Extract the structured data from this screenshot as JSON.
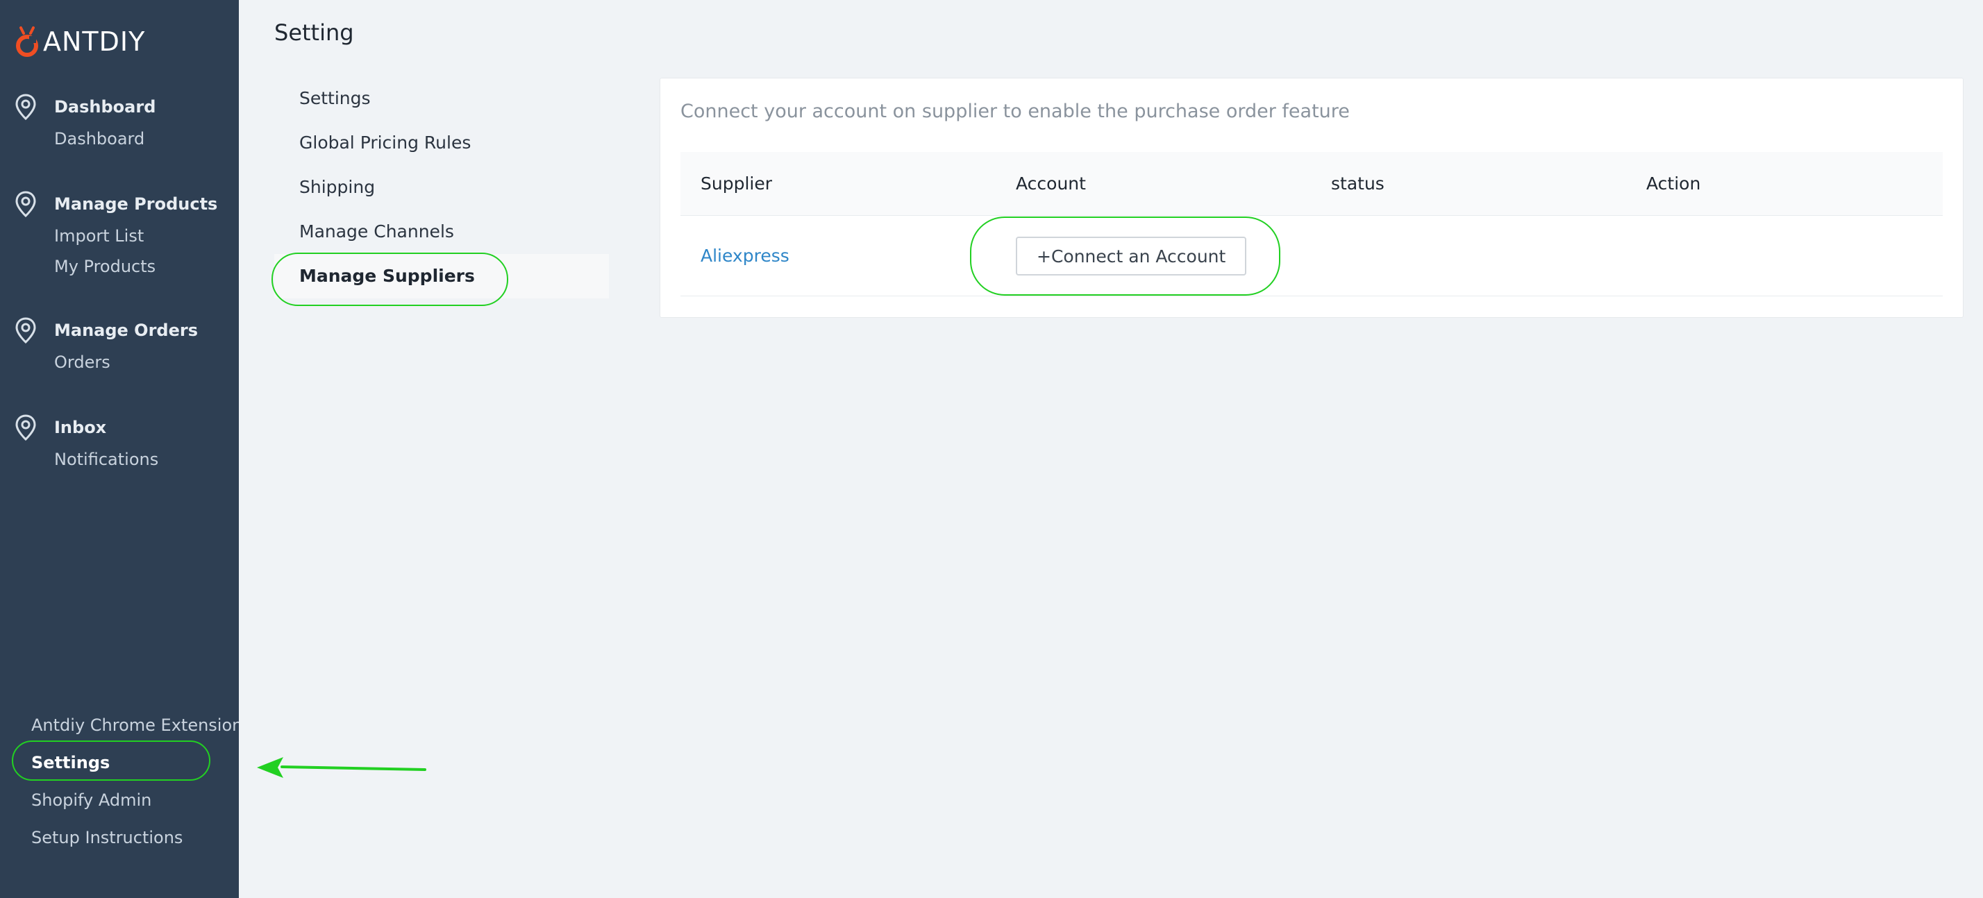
{
  "brand": {
    "name": "ANTDIY"
  },
  "sidebar": {
    "groups": [
      {
        "title": "Dashboard",
        "icon": "location-pin-icon",
        "items": [
          "Dashboard"
        ]
      },
      {
        "title": "Manage Products",
        "icon": "location-pin-icon",
        "items": [
          "Import List",
          "My Products"
        ]
      },
      {
        "title": "Manage Orders",
        "icon": "location-pin-icon",
        "items": [
          "Orders"
        ]
      },
      {
        "title": "Inbox",
        "icon": "location-pin-icon",
        "items": [
          "Notifications"
        ]
      }
    ],
    "footer": [
      {
        "label": "Antdiy Chrome Extension"
      },
      {
        "label": "Settings",
        "active": true
      },
      {
        "label": "Shopify Admin"
      },
      {
        "label": "Setup Instructions"
      }
    ]
  },
  "page": {
    "title": "Setting"
  },
  "submenu": {
    "items": [
      {
        "label": "Settings"
      },
      {
        "label": "Global Pricing Rules"
      },
      {
        "label": "Shipping"
      },
      {
        "label": "Manage Channels"
      },
      {
        "label": "Manage Suppliers",
        "active": true
      }
    ]
  },
  "suppliers": {
    "description": "Connect your account on supplier to enable the purchase order feature",
    "columns": [
      "Supplier",
      "Account",
      "status",
      "Action"
    ],
    "rows": [
      {
        "supplier": "Aliexpress",
        "account_button": "+Connect an Account",
        "status": "",
        "action": ""
      }
    ]
  },
  "colors": {
    "sidebar_bg": "#2e3f53",
    "page_bg": "#f0f3f6",
    "link": "#2e86c8",
    "annotation": "#22d022",
    "logo_accent": "#f04e23"
  }
}
